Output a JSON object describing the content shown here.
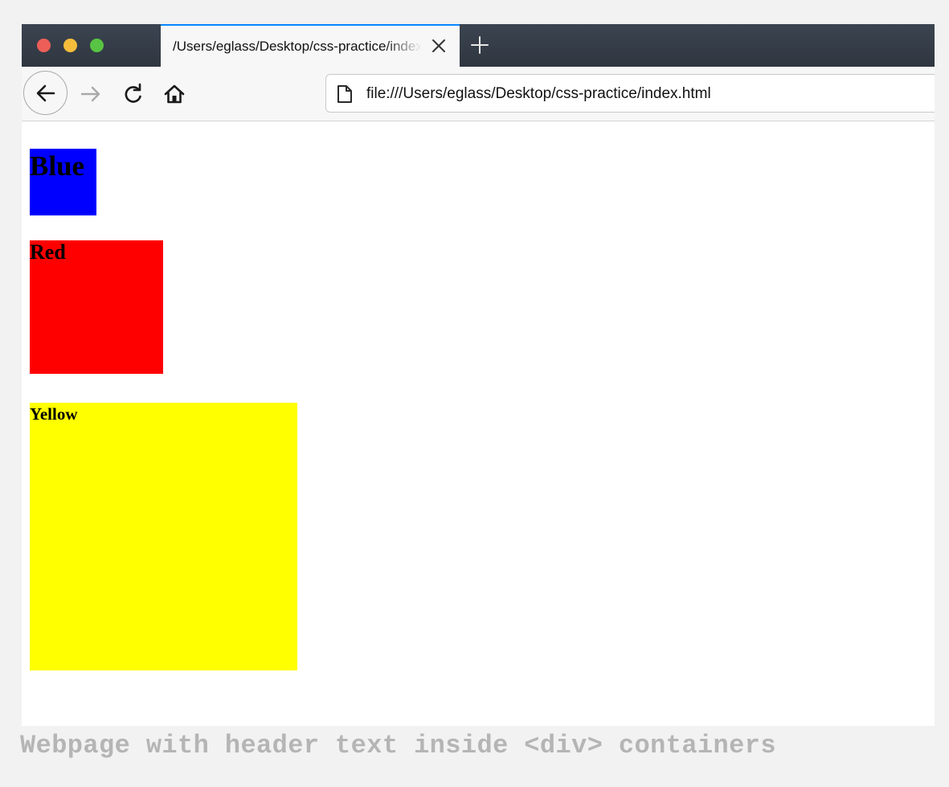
{
  "browser": {
    "tab": {
      "title": "/Users/eglass/Desktop/css-practice/index.html",
      "close_icon": "close-icon",
      "active_accent": "#0a84ff"
    },
    "new_tab_icon": "plus-icon",
    "toolbar": {
      "back_icon": "back-arrow-icon",
      "forward_icon": "forward-arrow-icon",
      "reload_icon": "reload-icon",
      "home_icon": "home-icon"
    },
    "urlbar": {
      "page_icon": "page-icon",
      "url": "file:///Users/eglass/Desktop/css-practice/index.html"
    },
    "window_controls": [
      "close",
      "minimize",
      "maximize"
    ]
  },
  "page": {
    "boxes": [
      {
        "label": "Blue",
        "color": "#0000ff"
      },
      {
        "label": "Red",
        "color": "#ff0000"
      },
      {
        "label": "Yellow",
        "color": "#ffff00"
      }
    ]
  },
  "caption": "Webpage with header text inside <div> containers"
}
